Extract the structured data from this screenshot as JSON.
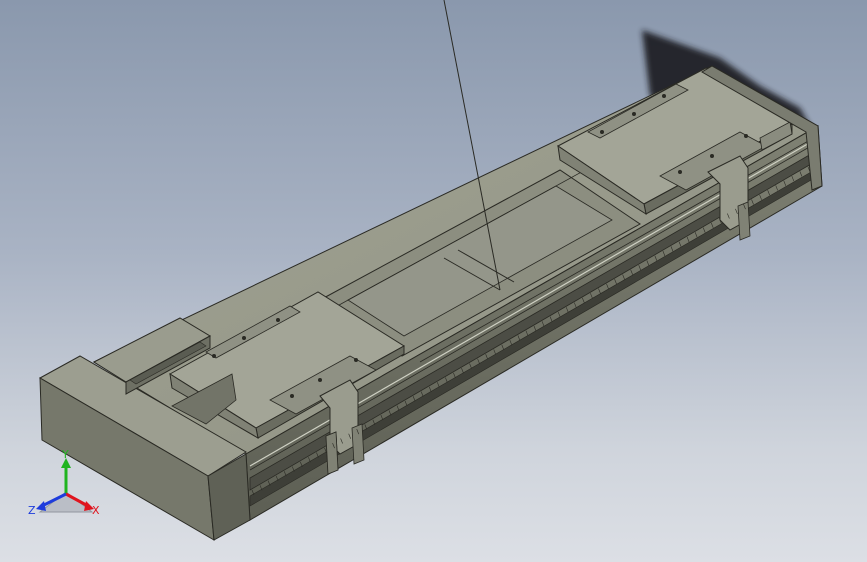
{
  "viewport": {
    "background_top": "#8a98ad",
    "background_bottom": "#dcdfe5"
  },
  "model": {
    "part_color": "#96988a",
    "edge_color": "#2a2a24",
    "rail_color": "#4c4d45"
  },
  "triad": {
    "x_label": "X",
    "y_label": "Y",
    "z_label": "Z",
    "x_color": "#e0141e",
    "y_color": "#1fb41f",
    "z_color": "#1e3cdc"
  }
}
